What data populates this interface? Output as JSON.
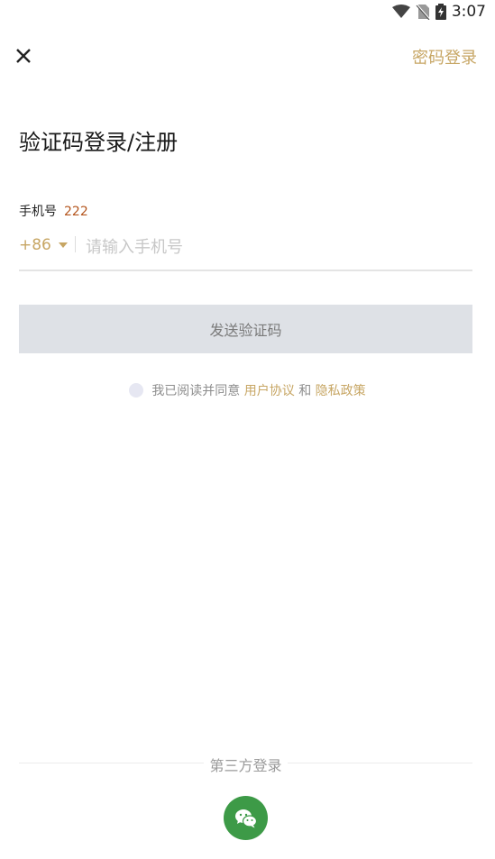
{
  "status_bar": {
    "time": "3:07"
  },
  "header": {
    "password_login": "密码登录"
  },
  "title": "验证码登录/注册",
  "phone": {
    "label": "手机号",
    "label_note": "222",
    "country_code": "+86",
    "placeholder": "请输入手机号",
    "value": ""
  },
  "send_button": "发送验证码",
  "agreement": {
    "prefix": "我已阅读并同意",
    "user_agreement": "用户协议",
    "and": "和",
    "privacy_policy": "隐私政策"
  },
  "third_party": {
    "label": "第三方登录"
  },
  "colors": {
    "accent": "#c7a664",
    "note": "#b4551d",
    "wechat": "#3d9a47",
    "button_bg": "#dee1e6"
  }
}
